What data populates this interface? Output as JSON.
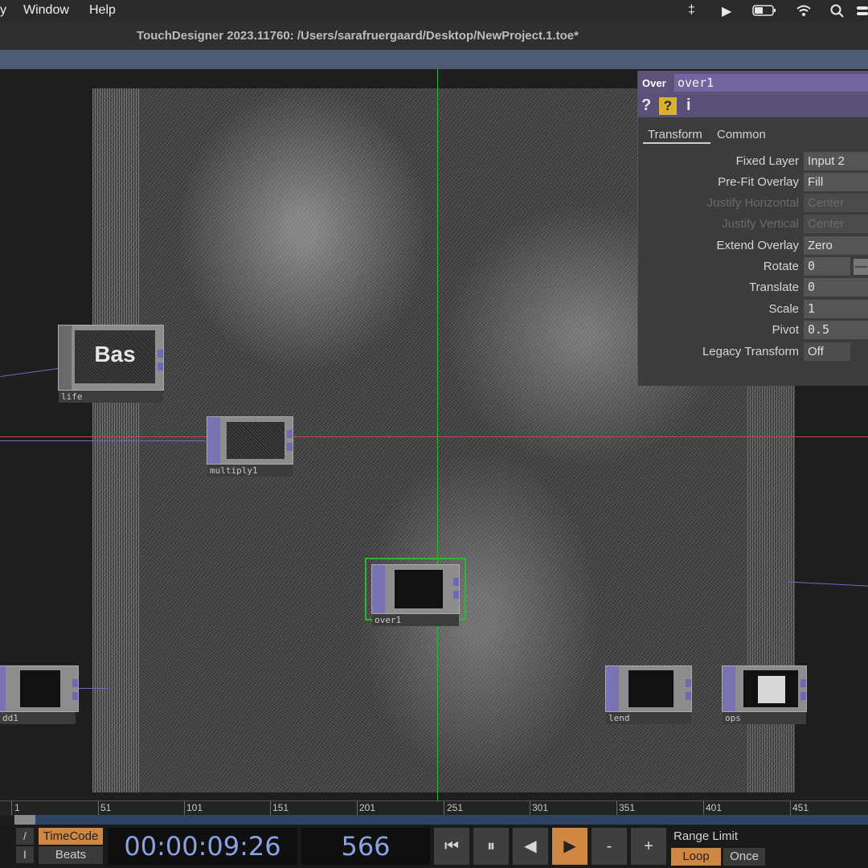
{
  "menubar": {
    "items": [
      "Window",
      "Help"
    ],
    "icons": [
      "airpods-icon",
      "play-icon",
      "battery-icon",
      "wifi-icon",
      "search-icon",
      "control-center-icon"
    ]
  },
  "window": {
    "title": "TouchDesigner 2023.11760: /Users/sarafruergaard/Desktop/NewProject.1.toe*"
  },
  "network": {
    "nodes": {
      "life": {
        "label": "life",
        "thumb_text": "Bas"
      },
      "mid": {
        "label": "multiply1"
      },
      "over": {
        "label": "over1"
      },
      "add": {
        "label": "dd1"
      },
      "lend": {
        "label": "lend"
      },
      "ops": {
        "label": "ops"
      }
    }
  },
  "params": {
    "op_type": "Over",
    "op_name": "over1",
    "tabs": [
      "Transform",
      "Common"
    ],
    "rows": [
      {
        "label": "Fixed Layer",
        "value": "Input 2",
        "enabled": true
      },
      {
        "label": "Pre-Fit Overlay",
        "value": "Fill",
        "enabled": true
      },
      {
        "label": "Justify Horizontal",
        "value": "Center",
        "enabled": false
      },
      {
        "label": "Justify Vertical",
        "value": "Center",
        "enabled": false
      },
      {
        "label": "Extend Overlay",
        "value": "Zero",
        "enabled": true
      },
      {
        "label": "Rotate",
        "value": "0",
        "enabled": true
      },
      {
        "label": "Translate",
        "value": "0",
        "enabled": true
      },
      {
        "label": "Scale",
        "value": "1",
        "enabled": true
      },
      {
        "label": "Pivot",
        "value": "0.5",
        "enabled": true
      },
      {
        "label": "Legacy Transform",
        "value": "Off",
        "enabled": true
      }
    ]
  },
  "timeline": {
    "ticks": [
      "1",
      "51",
      "101",
      "151",
      "201",
      "251",
      "301",
      "351",
      "401",
      "451"
    ]
  },
  "transport": {
    "slash": "/",
    "i": "I",
    "timecode_mode": "TimeCode",
    "beats_mode": "Beats",
    "timecode": "00:00:09:26",
    "frame": "566",
    "buttons": [
      "⏮",
      "⏸",
      "◀",
      "▶",
      "-",
      "+"
    ],
    "range_limit": "Range Limit",
    "loop": "Loop",
    "once": "Once"
  }
}
